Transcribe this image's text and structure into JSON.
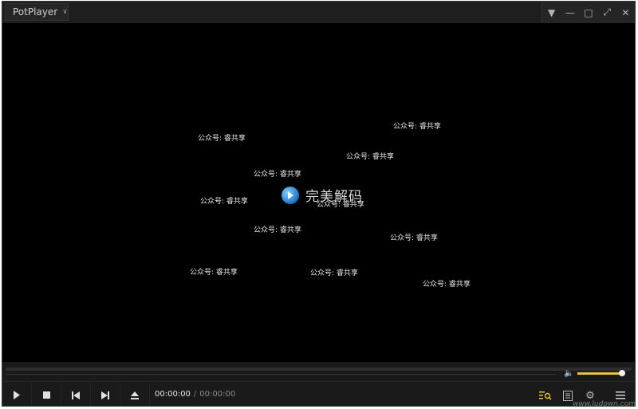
{
  "app": {
    "title": "PotPlayer"
  },
  "window_controls": [
    "pin-icon",
    "minimize-icon",
    "maximize-icon",
    "fullscreen-icon",
    "close-icon"
  ],
  "video": {
    "logo_text": "完美解码",
    "watermark_text": "公众号: 睿共享"
  },
  "playback": {
    "current_time": "00:00:00",
    "separator": "/",
    "duration": "00:00:00",
    "progress": 0,
    "volume": 1.0
  },
  "controls": [
    "play-icon",
    "stop-icon",
    "previous-icon",
    "next-icon",
    "eject-icon"
  ],
  "right_controls": [
    "playlist-search-icon",
    "chapters-icon",
    "settings-gear-icon",
    "menu-icon"
  ],
  "site_watermark": "www.ludown.com",
  "colors": {
    "accent": "#e9c43a",
    "background": "#000000",
    "panel": "#1a1a1a"
  }
}
